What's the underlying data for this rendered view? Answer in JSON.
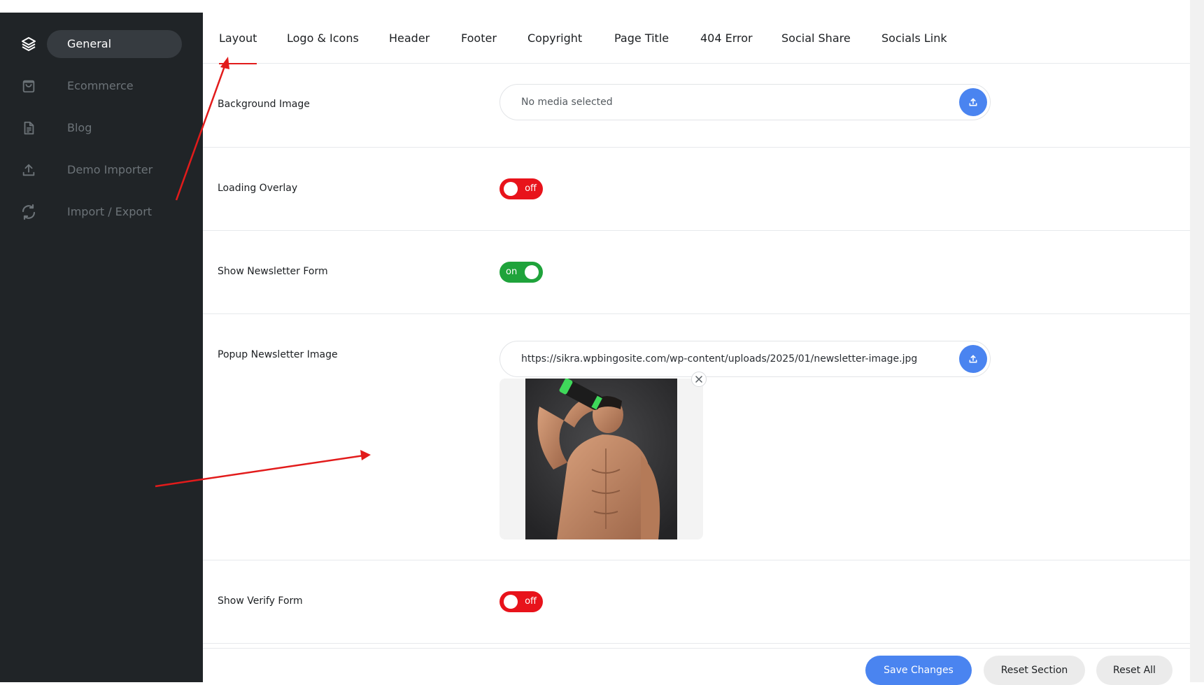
{
  "sidebar": {
    "items": [
      {
        "label": "General",
        "icon": "layers-icon",
        "active": true
      },
      {
        "label": "Ecommerce",
        "icon": "bag-icon",
        "active": false
      },
      {
        "label": "Blog",
        "icon": "document-icon",
        "active": false
      },
      {
        "label": "Demo Importer",
        "icon": "upload-icon",
        "active": false
      },
      {
        "label": "Import / Export",
        "icon": "sync-icon",
        "active": false
      }
    ]
  },
  "tabs": [
    {
      "label": "Layout",
      "active": true
    },
    {
      "label": "Logo & Icons",
      "active": false
    },
    {
      "label": "Header",
      "active": false
    },
    {
      "label": "Footer",
      "active": false
    },
    {
      "label": "Copyright",
      "active": false
    },
    {
      "label": "Page Title",
      "active": false
    },
    {
      "label": "404 Error",
      "active": false
    },
    {
      "label": "Social Share",
      "active": false
    },
    {
      "label": "Socials Link",
      "active": false
    }
  ],
  "fields": {
    "background_image": {
      "label": "Background Image",
      "value": "No media selected"
    },
    "loading_overlay": {
      "label": "Loading Overlay",
      "state": "off"
    },
    "newsletter_form": {
      "label": "Show Newsletter Form",
      "state": "on"
    },
    "popup_image": {
      "label": "Popup Newsletter Image",
      "value": "https://sikra.wpbingosite.com/wp-content/uploads/2025/01/newsletter-image.jpg"
    },
    "verify_form": {
      "label": "Show Verify Form",
      "state": "off"
    }
  },
  "footer": {
    "save": "Save Changes",
    "reset_section": "Reset Section",
    "reset_all": "Reset All"
  },
  "colors": {
    "sidebar_bg": "#202427",
    "accent_blue": "#4a84f0",
    "toggle_off": "#e8131b",
    "toggle_on": "#1fa33b",
    "annotation_red": "#e21b1b"
  }
}
